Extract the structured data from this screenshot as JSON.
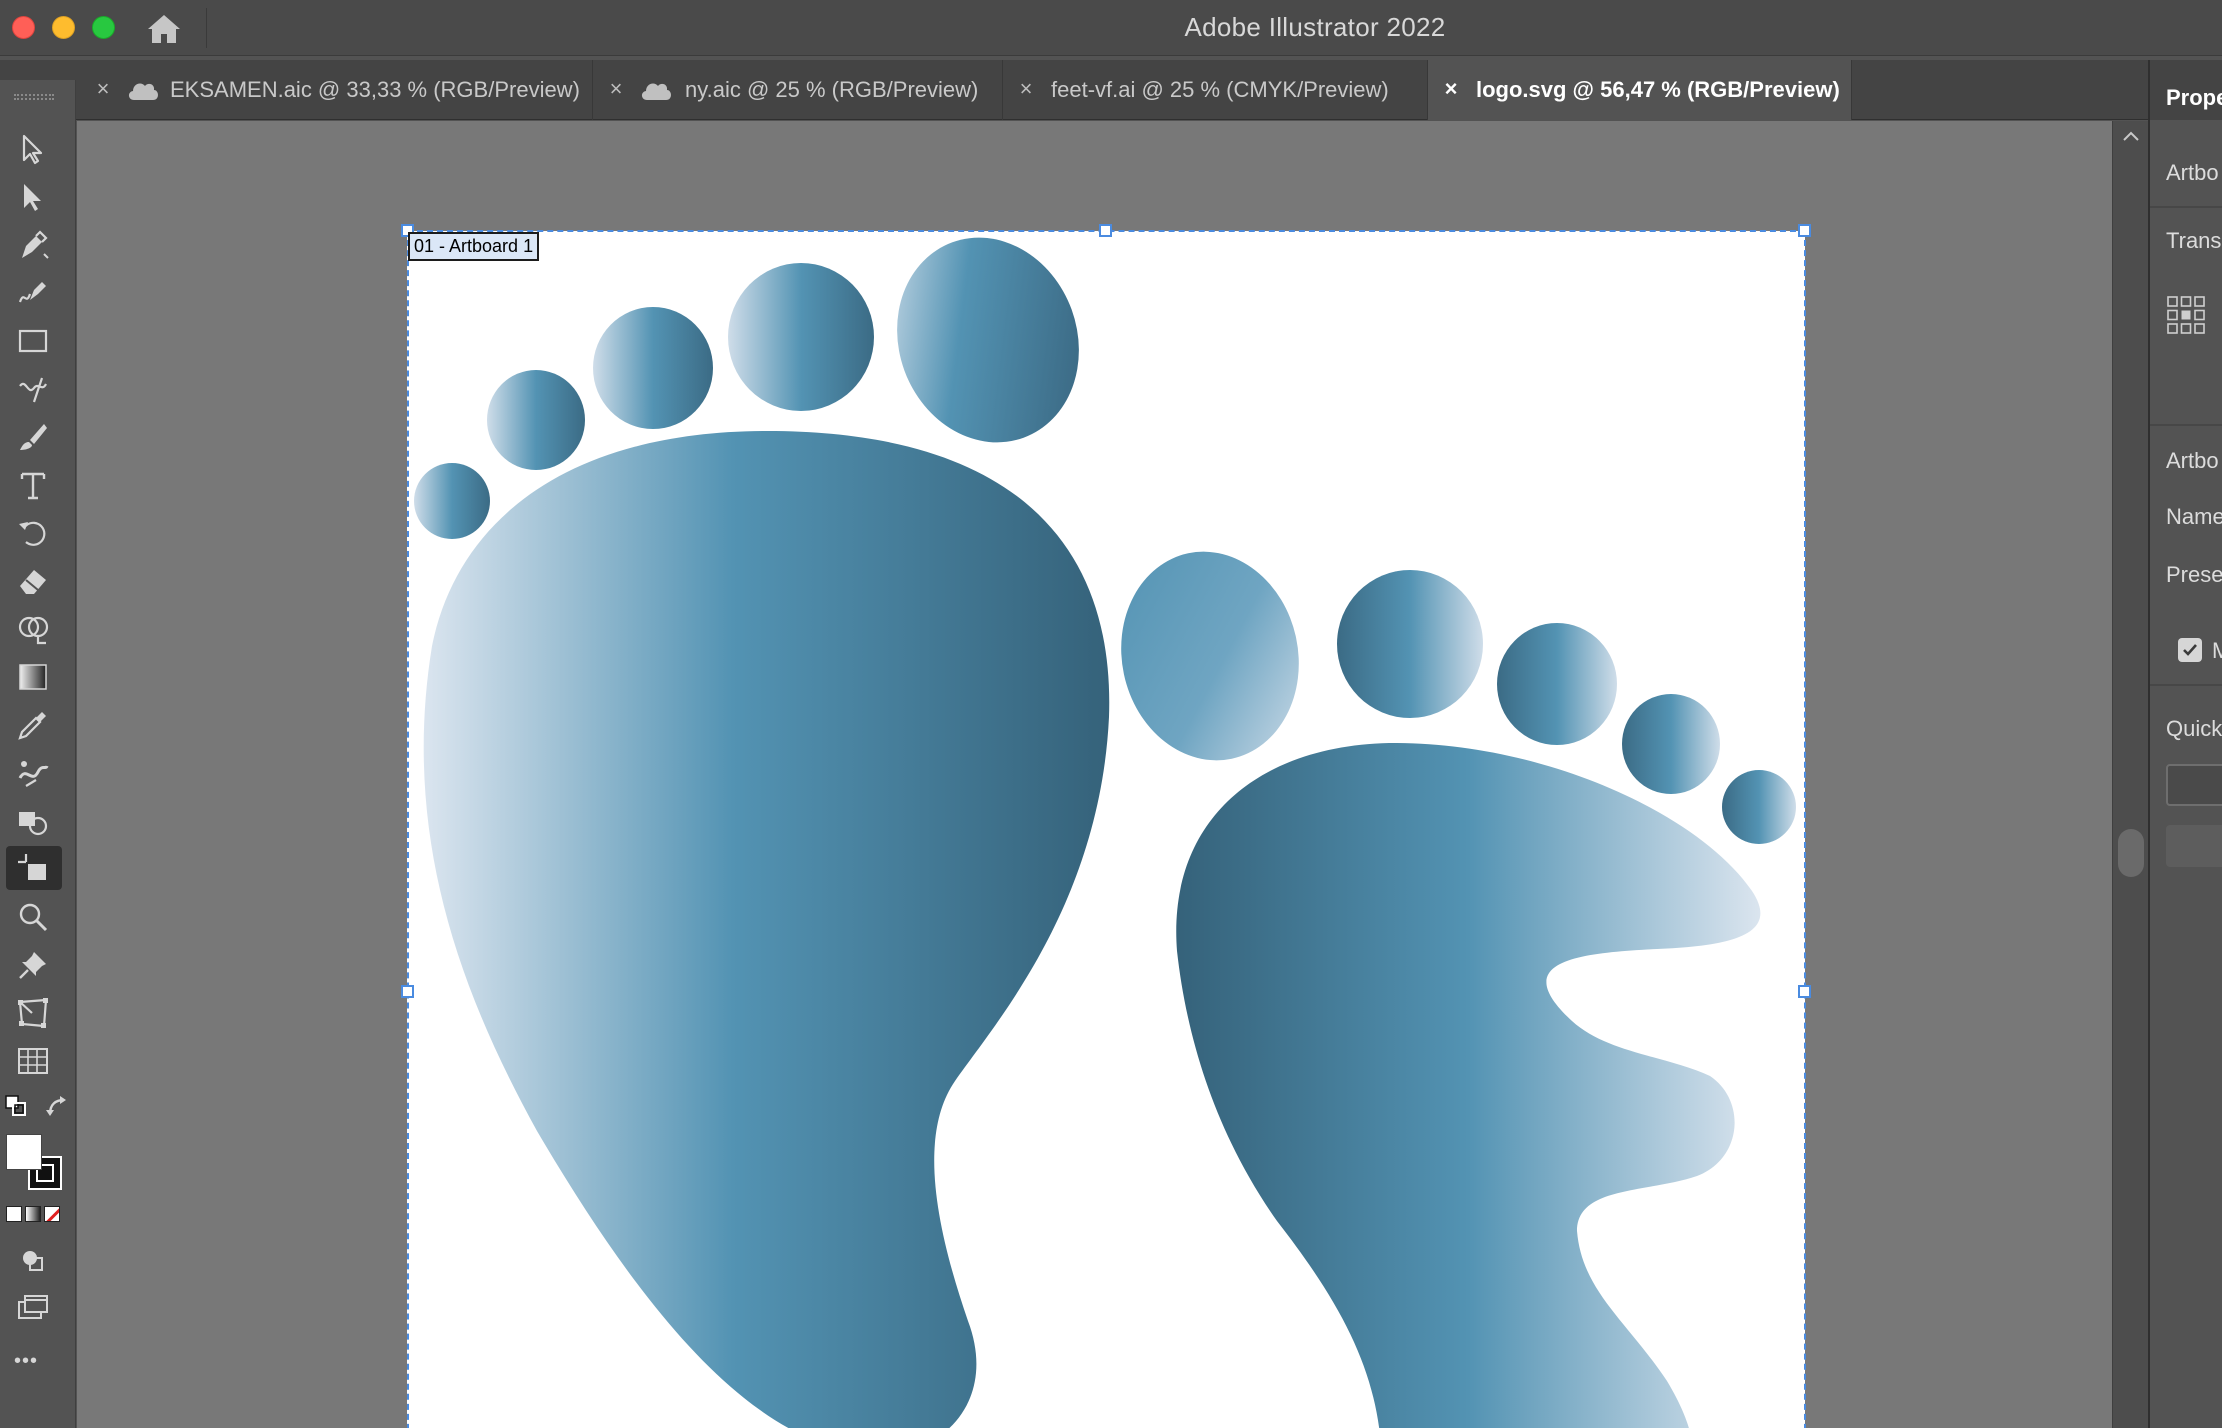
{
  "app_title": "Adobe Illustrator 2022",
  "tabs": [
    {
      "label": "EKSAMEN.aic @ 33,33 % (RGB/Preview)",
      "cloud": true,
      "active": false
    },
    {
      "label": "ny.aic @ 25 % (RGB/Preview)",
      "cloud": true,
      "active": false
    },
    {
      "label": "feet-vf.ai @ 25 % (CMYK/Preview)",
      "cloud": false,
      "active": false
    },
    {
      "label": "logo.svg @ 56,47 % (RGB/Preview)",
      "cloud": false,
      "active": true
    }
  ],
  "tab_close_glyph": "×",
  "collapse_glyph": "››",
  "artboard": {
    "label": "01 - Artboard 1"
  },
  "properties_panel": {
    "title": "Prope",
    "section_artboard": "Artbo",
    "section_transform": "Trans",
    "section_artboard_2": "Artbo",
    "name_label": "Name",
    "preset_label": "Prese",
    "checkbox_label": "M",
    "checkbox_checked": true,
    "section_quick": "Quick"
  },
  "toolbar": {
    "more_glyph": "•••",
    "tools": [
      "selection-tool",
      "direct-selection-tool",
      "pen-tool",
      "curvature-tool",
      "rectangle-tool",
      "shaper-tool",
      "paintbrush-tool",
      "type-tool",
      "rotate-tool",
      "eraser-tool",
      "shape-builder-tool",
      "gradient-tool",
      "eyedropper-tool",
      "puppet-warp-tool",
      "live-paint-bucket-tool",
      "artboard-tool",
      "zoom-tool",
      "pin-tool",
      "free-transform-tool",
      "graph-tool"
    ],
    "selected_tool": "artboard-tool"
  },
  "colors": {
    "foot_dark": "#35627a",
    "foot_mid": "#5393b3",
    "foot_light": "#dbe5ef",
    "artboard_border": "#4a8be0",
    "active_tab_bg": "#535353"
  }
}
